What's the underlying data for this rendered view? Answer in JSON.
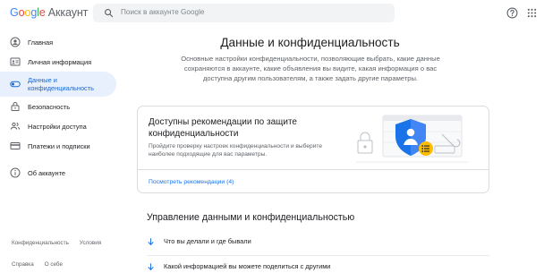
{
  "header": {
    "logo_letters": [
      "G",
      "o",
      "o",
      "g",
      "l",
      "e"
    ],
    "product": "Аккаунт",
    "search_placeholder": "Поиск в аккаунте Google",
    "icons": {
      "search": "search-icon",
      "help": "help-icon",
      "apps": "apps-grid-icon"
    }
  },
  "sidebar": {
    "items": [
      {
        "label": "Главная",
        "icon": "account-circle-icon"
      },
      {
        "label": "Личная информация",
        "icon": "id-card-icon"
      },
      {
        "label": "Данные и конфиденциальность",
        "icon": "toggle-icon",
        "active": true
      },
      {
        "label": "Безопасность",
        "icon": "lock-icon"
      },
      {
        "label": "Настройки доступа",
        "icon": "people-icon"
      },
      {
        "label": "Платежи и подписки",
        "icon": "credit-card-icon"
      },
      {
        "label": "Об аккаунте",
        "icon": "info-icon"
      }
    ],
    "footer_row1": [
      "Конфиденциальность",
      "Условия"
    ],
    "footer_row2": [
      "Справка",
      "О себе"
    ]
  },
  "main": {
    "title": "Данные и конфиденциальность",
    "subtitle": "Основные настройки конфиденциальности, позволяющие выбрать, какие данные сохраняются в аккаунте, какие объявления вы видите, какая информация о вас доступна другим пользователям, а также задать другие параметры.",
    "card": {
      "title": "Доступны рекомендации по защите конфиденциальности",
      "description": "Пройдите проверку настроек конфиденциальности и выберите наиболее подходящие для вас параметры.",
      "link": "Посмотреть рекомендации (4)"
    },
    "section_title": "Управление данными и конфиденциальностью",
    "rows": [
      {
        "label": "Что вы делали и где бывали",
        "icon": "arrow-down-icon"
      },
      {
        "label": "Какой информацией вы можете поделиться с другими",
        "icon": "arrow-down-icon"
      }
    ]
  },
  "colors": {
    "accent": "#1a73e8",
    "active_bg": "#e8f0fe",
    "active_text": "#1967d2",
    "shield": "#1a73e8",
    "list_badge": "#fbbc04"
  }
}
